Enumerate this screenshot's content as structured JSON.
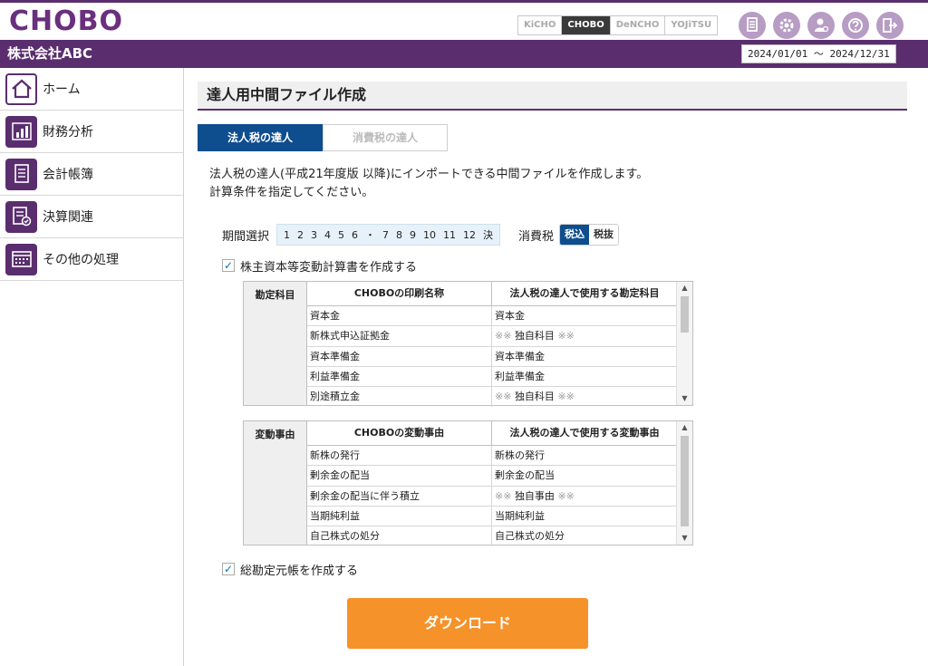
{
  "app": {
    "logo_text": "CHOBO",
    "products": [
      "KiCHO",
      "CHOBO",
      "DeNCHO",
      "YOJiTSU"
    ],
    "active_product": "CHOBO",
    "top_icons": [
      "document-icon",
      "gear-icon",
      "user-settings-icon",
      "help-icon",
      "logout-icon"
    ]
  },
  "company": {
    "name": "株式会社ABC",
    "period": "2024/01/01 ～ 2024/12/31"
  },
  "sidebar": {
    "items": [
      {
        "label": "ホーム",
        "icon": "home-icon"
      },
      {
        "label": "財務分析",
        "icon": "bar-chart-icon"
      },
      {
        "label": "会計帳簿",
        "icon": "ledger-icon"
      },
      {
        "label": "決算関連",
        "icon": "settlement-icon"
      },
      {
        "label": "その他の処理",
        "icon": "calendar-icon"
      }
    ]
  },
  "main": {
    "title": "達人用中間ファイル作成",
    "tabs": [
      {
        "label": "法人税の達人",
        "active": true
      },
      {
        "label": "消費税の達人",
        "active": false
      }
    ],
    "description_line1": "法人税の達人(平成21年度版 以降)にインポートできる中間ファイルを作成します。",
    "description_line2": "計算条件を指定してください。",
    "period_select": {
      "label": "期間選択",
      "numbers": [
        "1",
        "2",
        "3",
        "4",
        "5",
        "6",
        "・",
        "7",
        "8",
        "9",
        "10",
        "11",
        "12",
        "決"
      ]
    },
    "consumption_tax": {
      "label": "消費税",
      "options": [
        "税込",
        "税抜"
      ],
      "selected": "税込"
    },
    "check_equity": {
      "label": "株主資本等変動計算書を作成する",
      "checked": true
    },
    "accounts_table": {
      "side_header": "勘定科目",
      "col1": "CHOBOの印刷名称",
      "col2": "法人税の達人で使用する勘定科目",
      "rows": [
        {
          "chobo": "資本金",
          "tatsujin": "資本金",
          "custom": false
        },
        {
          "chobo": "新株式申込証拠金",
          "tatsujin": "独自科目",
          "custom": true
        },
        {
          "chobo": "資本準備金",
          "tatsujin": "資本準備金",
          "custom": false
        },
        {
          "chobo": "利益準備金",
          "tatsujin": "利益準備金",
          "custom": false
        },
        {
          "chobo": "別途積立金",
          "tatsujin": "独自科目",
          "custom": true
        }
      ]
    },
    "events_table": {
      "side_header": "変動事由",
      "col1": "CHOBOの変動事由",
      "col2": "法人税の達人で使用する変動事由",
      "rows": [
        {
          "chobo": "新株の発行",
          "tatsujin": "新株の発行",
          "custom": false
        },
        {
          "chobo": "剰余金の配当",
          "tatsujin": "剰余金の配当",
          "custom": false
        },
        {
          "chobo": "剰余金の配当に伴う積立",
          "tatsujin": "独自事由",
          "custom": true
        },
        {
          "chobo": "当期純利益",
          "tatsujin": "当期純利益",
          "custom": false
        },
        {
          "chobo": "自己株式の処分",
          "tatsujin": "自己株式の処分",
          "custom": false
        }
      ]
    },
    "custom_mark": "※※",
    "check_ledger": {
      "label": "総勘定元帳を作成する",
      "checked": true
    },
    "download_label": "ダウンロード"
  },
  "colors": {
    "brand_purple": "#5a2e6e",
    "accent_blue": "#0e4d8e",
    "download_orange": "#f6922a"
  }
}
